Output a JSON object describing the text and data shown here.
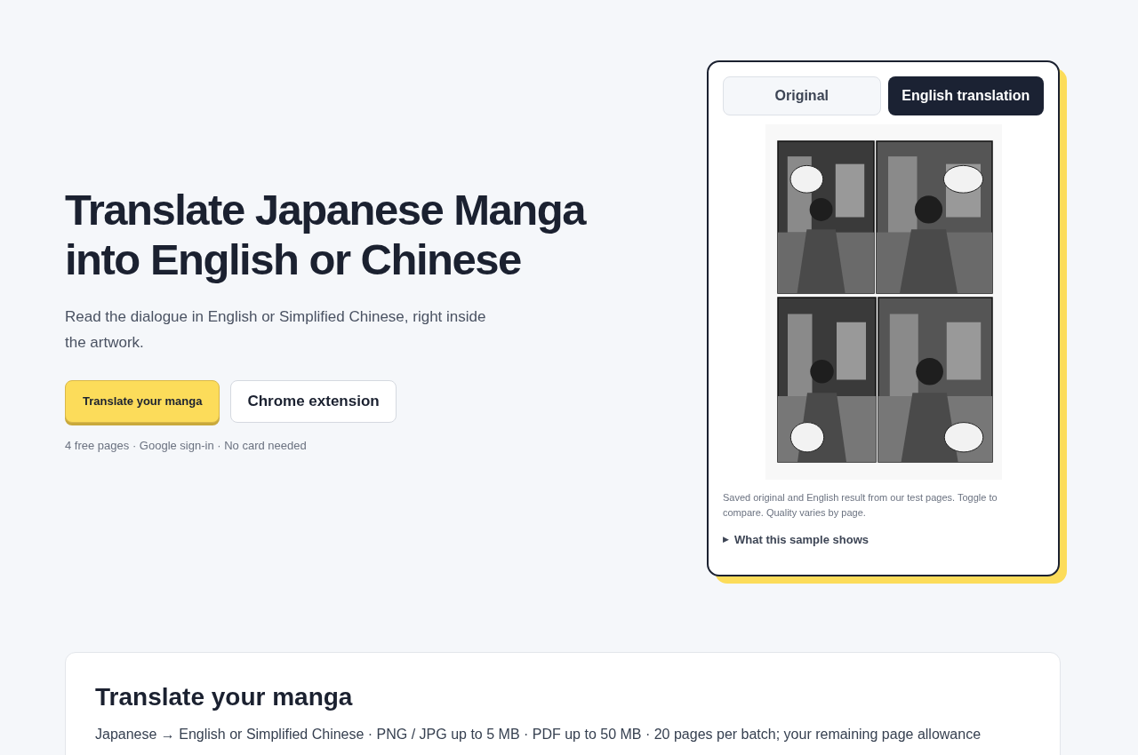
{
  "hero": {
    "title": "Translate Japanese Manga into English or Chinese",
    "subtitle": "Read the dialogue in English or Simplified Chinese, right inside the artwork.",
    "buttons": [
      {
        "kind": "primary",
        "label": "Translate your manga"
      },
      {
        "kind": "secondary",
        "label": "Chrome extension"
      }
    ],
    "note": "4 free pages · Google sign-in · No card needed"
  },
  "sample": {
    "tabs": [
      {
        "label": "Original",
        "selected": false
      },
      {
        "label": "English translation",
        "selected": true
      }
    ],
    "caption": "Saved original and English result from our test pages. Toggle to compare. Quality varies by page.",
    "details": {
      "marker": "▶",
      "label": "What this sample shows",
      "expanded": false
    }
  },
  "translate_section": {
    "title": "Translate your manga",
    "description": "Japanese → English or Simplified Chinese · PNG / JPG up to 5 MB · PDF up to 50 MB · 20 pages per batch; your remaining page allowance"
  }
}
